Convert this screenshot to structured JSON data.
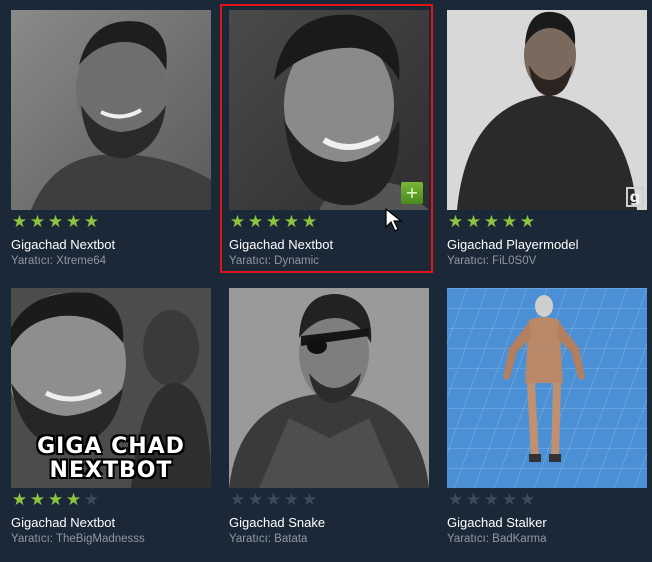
{
  "items": [
    {
      "title": "Gigachad Nextbot",
      "author": "Yaratıcı: Xtreme64",
      "rating": 5
    },
    {
      "title": "Gigachad Nextbot",
      "author": "Yaratıcı: Dynamic",
      "rating": 5,
      "selected": true,
      "add_label": "+"
    },
    {
      "title": "Gigachad Playermodel",
      "author": "Yaratıcı: FiL0S0V",
      "rating": 5,
      "badge": "g"
    },
    {
      "title": "Gigachad Nextbot",
      "author": "Yaratıcı: TheBigMadnesss",
      "rating": 4,
      "overlay_line1": "GIGA CHAD",
      "overlay_line2": "NEXTBOT"
    },
    {
      "title": "Gigachad Snake",
      "author": "Yaratıcı: Batata",
      "rating": 0
    },
    {
      "title": "Gigachad Stalker",
      "author": "Yaratıcı: BadKarma",
      "rating": 0
    }
  ],
  "colors": {
    "background": "#1b2838",
    "star_on": "#8bc53f",
    "star_off": "#3b4a5c",
    "selection_border": "#e01414",
    "author_text": "#8f98a0"
  },
  "icons": {
    "star": "star-icon",
    "add": "plus-icon",
    "cursor": "mouse-cursor-icon",
    "gmod": "gmod-logo-icon"
  }
}
